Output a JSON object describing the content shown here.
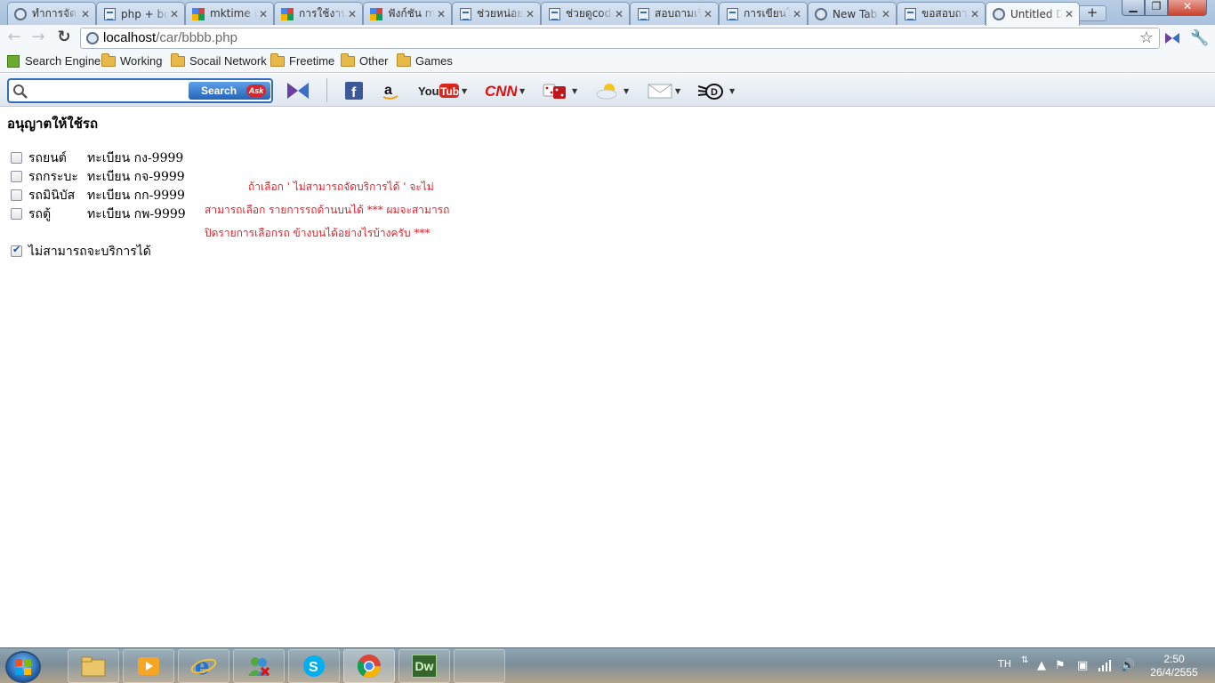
{
  "browser": {
    "tabs": [
      {
        "title": "ทำการจัดร",
        "icon": "globe-icon"
      },
      {
        "title": "php + bor",
        "icon": "page-icon"
      },
      {
        "title": "mktime ดึ",
        "icon": "google-icon"
      },
      {
        "title": "การใช้งาน",
        "icon": "google-icon"
      },
      {
        "title": "ฟังก์ชัน mi",
        "icon": "google-icon"
      },
      {
        "title": "ช่วยหน่อยค",
        "icon": "page-icon"
      },
      {
        "title": "ช่วยดูcode",
        "icon": "page-icon"
      },
      {
        "title": "สอบถามเรื่",
        "icon": "page-icon"
      },
      {
        "title": "การเขียนโ",
        "icon": "page-icon"
      },
      {
        "title": "New Tab",
        "icon": "globe-icon"
      },
      {
        "title": "ขอสอบถาม",
        "icon": "page-icon"
      },
      {
        "title": "Untitled D",
        "icon": "globe-icon",
        "active": true
      }
    ],
    "address": {
      "host": "localhost",
      "path": "/car/bbbb.php"
    },
    "bookmarks": [
      {
        "label": "Search Engine"
      },
      {
        "label": "Working"
      },
      {
        "label": "Socail Network"
      },
      {
        "label": "Freetime"
      },
      {
        "label": "Other"
      },
      {
        "label": "Games"
      }
    ],
    "ask_toolbar": {
      "search_placeholder": "",
      "search_button": "Search",
      "ask_logo": "Ask",
      "shortcuts": [
        "logo-icon",
        "facebook-icon",
        "amazon-icon",
        "youtube-icon",
        "cnn-icon",
        "games-icon",
        "weather-icon",
        "mail-icon",
        "dictionary-icon"
      ]
    }
  },
  "page": {
    "title": "อนุญาตให้ใช้รถ",
    "cars": [
      {
        "name": "รถยนต์",
        "plate": "ทะเบียน กง-9999",
        "checked": false
      },
      {
        "name": "รถกระบะ",
        "plate": "ทะเบียน กจ-9999",
        "checked": false
      },
      {
        "name": "รถมินิบัส",
        "plate": "ทะเบียน กก-9999",
        "checked": false
      },
      {
        "name": "รถตู้",
        "plate": "ทะเบียน กพ-9999",
        "checked": false
      }
    ],
    "unavailable": {
      "label": "ไม่สามารถจะบริการได้",
      "checked": true
    },
    "note_lines": [
      "ถ้าเลือก ' ไม่สามารถจัดบริการได้ ' จะไม่",
      "สามารถเลือก รายการรถด้านบนได้ *** ผมจะสามารถ",
      "ปิดรายการเลือกรถ ข้างบนได้อย่างไรบ้างครับ ***"
    ],
    "note_color": "#e0222a"
  },
  "taskbar": {
    "apps": [
      "explorer-icon",
      "media-player-icon",
      "internet-explorer-icon",
      "messenger-icon",
      "skype-icon",
      "chrome-icon",
      "dreamweaver-icon",
      "blank-window"
    ],
    "dreamweaver_label": "Dw",
    "language": "TH",
    "time": "2:50",
    "date": "26/4/2555"
  }
}
